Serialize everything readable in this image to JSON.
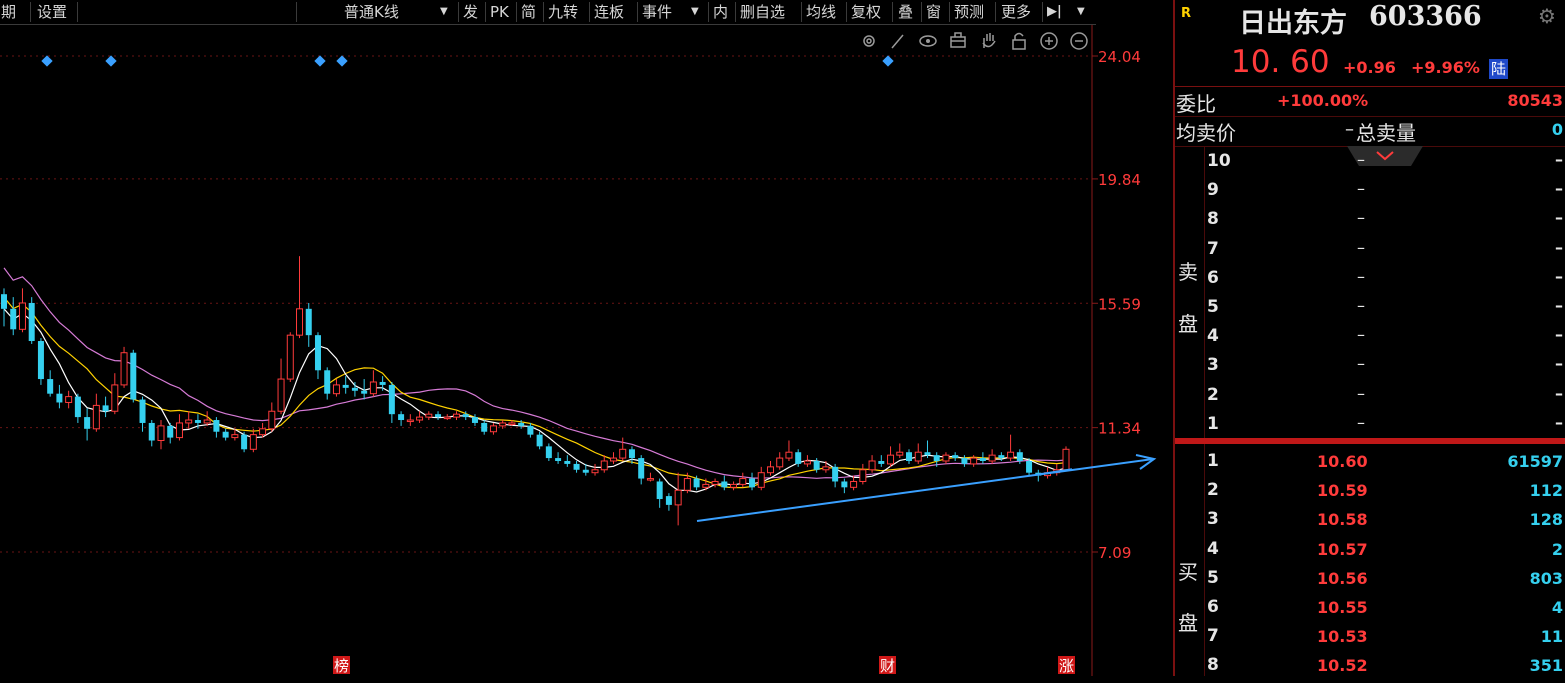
{
  "toolbar": {
    "items": [
      "周期",
      "设置",
      "普通K线",
      "发",
      "PK",
      "简",
      "九转",
      "连板",
      "事件",
      "内",
      "删自选",
      "均线",
      "复权",
      "叠",
      "窗",
      "预测",
      "更多"
    ],
    "dropdown_arrow": "▼",
    "expand_glyph": "▶|",
    "expand_arrow": "▼"
  },
  "chart_tools": [
    "gear-tool-icon",
    "pen-icon",
    "eye-icon",
    "lock-box-icon",
    "hand-icon",
    "lock-icon",
    "zoom-in-icon",
    "zoom-out-icon"
  ],
  "markers": {
    "bottom_labels": [
      "榜",
      "财",
      "涨"
    ]
  },
  "chart_data": {
    "type": "candlestick",
    "y_ticks": [
      "24.04",
      "19.84",
      "15.59",
      "11.34",
      "7.09"
    ],
    "ylim": [
      7.09,
      24.04
    ],
    "colors": {
      "up": "#ff3b3b",
      "down": "#35d0ef",
      "ma5": "#ffffff",
      "ma10": "#ffd200",
      "ma20": "#d67bd6",
      "trend": "#3aa0ff"
    },
    "candles": [
      [
        15.9,
        15.4,
        16.1,
        14.8
      ],
      [
        15.4,
        14.7,
        15.8,
        14.5
      ],
      [
        14.7,
        15.6,
        16.1,
        14.6
      ],
      [
        15.6,
        14.3,
        15.8,
        14.2
      ],
      [
        14.3,
        13.0,
        14.4,
        12.8
      ],
      [
        13.0,
        12.5,
        13.3,
        12.4
      ],
      [
        12.5,
        12.2,
        12.8,
        12.0
      ],
      [
        12.2,
        12.4,
        12.6,
        12.0
      ],
      [
        12.4,
        11.7,
        12.5,
        11.5
      ],
      [
        11.7,
        11.3,
        12.0,
        10.9
      ],
      [
        11.3,
        12.1,
        12.5,
        11.2
      ],
      [
        12.1,
        11.9,
        12.4,
        11.7
      ],
      [
        11.9,
        12.8,
        13.2,
        11.8
      ],
      [
        12.8,
        13.9,
        14.1,
        12.7
      ],
      [
        13.9,
        12.3,
        14.0,
        12.2
      ],
      [
        12.3,
        11.5,
        12.4,
        11.2
      ],
      [
        11.5,
        10.9,
        11.6,
        10.7
      ],
      [
        10.9,
        11.4,
        11.6,
        10.6
      ],
      [
        11.4,
        11.0,
        11.5,
        10.8
      ],
      [
        11.0,
        11.5,
        11.8,
        10.9
      ],
      [
        11.5,
        11.6,
        11.9,
        11.3
      ],
      [
        11.6,
        11.5,
        11.8,
        11.3
      ],
      [
        11.5,
        11.6,
        11.9,
        11.4
      ],
      [
        11.6,
        11.2,
        11.7,
        11.0
      ],
      [
        11.2,
        11.0,
        11.3,
        10.9
      ],
      [
        11.0,
        11.1,
        11.3,
        10.9
      ],
      [
        11.1,
        10.6,
        11.2,
        10.5
      ],
      [
        10.6,
        11.1,
        11.3,
        10.5
      ],
      [
        11.1,
        11.3,
        11.5,
        11.0
      ],
      [
        11.3,
        11.9,
        12.2,
        11.2
      ],
      [
        11.9,
        13.0,
        13.7,
        11.8
      ],
      [
        13.0,
        14.5,
        14.6,
        12.9
      ],
      [
        14.5,
        15.4,
        17.2,
        14.4
      ],
      [
        15.4,
        14.5,
        15.6,
        14.1
      ],
      [
        14.5,
        13.3,
        14.6,
        13.0
      ],
      [
        13.3,
        12.5,
        13.4,
        12.3
      ],
      [
        12.5,
        12.8,
        13.0,
        12.4
      ],
      [
        12.8,
        12.7,
        13.1,
        12.5
      ],
      [
        12.7,
        12.6,
        12.9,
        12.4
      ],
      [
        12.6,
        12.5,
        13.0,
        12.3
      ],
      [
        12.5,
        12.9,
        13.3,
        12.4
      ],
      [
        12.9,
        12.8,
        13.1,
        12.6
      ],
      [
        12.8,
        11.8,
        12.9,
        11.5
      ],
      [
        11.8,
        11.6,
        11.9,
        11.4
      ],
      [
        11.6,
        11.6,
        11.8,
        11.4
      ],
      [
        11.6,
        11.7,
        11.9,
        11.5
      ],
      [
        11.7,
        11.8,
        11.9,
        11.6
      ],
      [
        11.8,
        11.7,
        11.9,
        11.6
      ],
      [
        11.7,
        11.7,
        11.8,
        11.6
      ],
      [
        11.7,
        11.8,
        11.9,
        11.6
      ],
      [
        11.8,
        11.7,
        11.9,
        11.6
      ],
      [
        11.7,
        11.5,
        11.8,
        11.4
      ],
      [
        11.5,
        11.2,
        11.6,
        11.1
      ],
      [
        11.2,
        11.4,
        11.5,
        11.1
      ],
      [
        11.4,
        11.5,
        11.6,
        11.3
      ],
      [
        11.5,
        11.5,
        11.6,
        11.4
      ],
      [
        11.5,
        11.4,
        11.6,
        11.3
      ],
      [
        11.4,
        11.1,
        11.5,
        11.0
      ],
      [
        11.1,
        10.7,
        11.2,
        10.6
      ],
      [
        10.7,
        10.3,
        10.8,
        10.2
      ],
      [
        10.3,
        10.2,
        10.5,
        10.1
      ],
      [
        10.2,
        10.1,
        10.4,
        10.0
      ],
      [
        10.1,
        9.9,
        10.2,
        9.8
      ],
      [
        9.9,
        9.8,
        10.1,
        9.7
      ],
      [
        9.8,
        9.9,
        10.1,
        9.7
      ],
      [
        9.9,
        10.2,
        10.4,
        9.8
      ],
      [
        10.2,
        10.3,
        10.5,
        10.1
      ],
      [
        10.3,
        10.6,
        11.0,
        10.2
      ],
      [
        10.6,
        10.3,
        10.7,
        10.1
      ],
      [
        10.3,
        9.6,
        10.4,
        9.4
      ],
      [
        9.6,
        9.6,
        9.8,
        9.5
      ],
      [
        9.5,
        8.9,
        9.6,
        8.6
      ],
      [
        9.0,
        8.7,
        9.1,
        8.5
      ],
      [
        8.7,
        9.2,
        9.8,
        8.0
      ],
      [
        9.2,
        9.6,
        9.8,
        9.1
      ],
      [
        9.6,
        9.3,
        9.7,
        9.2
      ],
      [
        9.3,
        9.4,
        9.6,
        9.2
      ],
      [
        9.4,
        9.5,
        9.6,
        9.3
      ],
      [
        9.5,
        9.3,
        9.7,
        9.2
      ],
      [
        9.3,
        9.4,
        9.5,
        9.2
      ],
      [
        9.4,
        9.6,
        9.8,
        9.3
      ],
      [
        9.6,
        9.3,
        9.8,
        9.2
      ],
      [
        9.3,
        9.8,
        10.0,
        9.2
      ],
      [
        9.8,
        10.0,
        10.2,
        9.7
      ],
      [
        10.0,
        10.3,
        10.5,
        9.9
      ],
      [
        10.3,
        10.5,
        10.9,
        10.2
      ],
      [
        10.5,
        10.1,
        10.6,
        10.0
      ],
      [
        10.1,
        10.2,
        10.4,
        10.0
      ],
      [
        10.2,
        9.9,
        10.3,
        9.8
      ],
      [
        9.9,
        10.0,
        10.2,
        9.8
      ],
      [
        10.0,
        9.5,
        10.1,
        9.3
      ],
      [
        9.5,
        9.3,
        9.6,
        9.1
      ],
      [
        9.3,
        9.5,
        9.7,
        9.2
      ],
      [
        9.5,
        9.9,
        10.1,
        9.4
      ],
      [
        9.9,
        10.2,
        10.4,
        9.8
      ],
      [
        10.2,
        10.1,
        10.4,
        10.0
      ],
      [
        10.1,
        10.4,
        10.7,
        10.0
      ],
      [
        10.4,
        10.5,
        10.8,
        10.3
      ],
      [
        10.5,
        10.2,
        10.6,
        10.1
      ],
      [
        10.2,
        10.5,
        10.8,
        10.1
      ],
      [
        10.5,
        10.4,
        10.9,
        10.3
      ],
      [
        10.4,
        10.2,
        10.5,
        10.0
      ],
      [
        10.2,
        10.4,
        10.5,
        10.1
      ],
      [
        10.4,
        10.3,
        10.5,
        10.2
      ],
      [
        10.3,
        10.1,
        10.4,
        10.0
      ],
      [
        10.1,
        10.3,
        10.4,
        10.0
      ],
      [
        10.3,
        10.2,
        10.5,
        10.1
      ],
      [
        10.2,
        10.4,
        10.6,
        10.1
      ],
      [
        10.4,
        10.3,
        10.5,
        10.2
      ],
      [
        10.3,
        10.5,
        11.1,
        10.2
      ],
      [
        10.5,
        10.2,
        10.6,
        10.1
      ],
      [
        10.2,
        9.8,
        10.3,
        9.7
      ],
      [
        9.8,
        9.7,
        9.9,
        9.5
      ],
      [
        9.7,
        9.8,
        10.0,
        9.6
      ],
      [
        9.8,
        9.9,
        10.1,
        9.7
      ],
      [
        9.9,
        10.6,
        10.7,
        9.9
      ]
    ]
  },
  "quote": {
    "badge": "R",
    "name": "日出东方",
    "code": "603366",
    "price": "10. 60",
    "change": "+0.96",
    "change_pct": "+9.96%",
    "market_tag": "陆",
    "wb_label": "委比",
    "wb_value": "+100.00%",
    "wb_diff": "80543",
    "avg_sell_label": "均卖价",
    "avg_sell_value": "–",
    "total_sell_label": "总卖量",
    "total_sell_value": "0",
    "sell_side_label": [
      "卖",
      "盘"
    ],
    "buy_side_label": [
      "买",
      "盘"
    ],
    "sell_rows": [
      {
        "level": "10",
        "price": "–",
        "vol": "–"
      },
      {
        "level": "9",
        "price": "–",
        "vol": "–"
      },
      {
        "level": "8",
        "price": "–",
        "vol": "–"
      },
      {
        "level": "7",
        "price": "–",
        "vol": "–"
      },
      {
        "level": "6",
        "price": "–",
        "vol": "–"
      },
      {
        "level": "5",
        "price": "–",
        "vol": "–"
      },
      {
        "level": "4",
        "price": "–",
        "vol": "–"
      },
      {
        "level": "3",
        "price": "–",
        "vol": "–"
      },
      {
        "level": "2",
        "price": "–",
        "vol": "–"
      },
      {
        "level": "1",
        "price": "–",
        "vol": "–"
      }
    ],
    "buy_rows": [
      {
        "level": "1",
        "price": "10.60",
        "vol": "61597"
      },
      {
        "level": "2",
        "price": "10.59",
        "vol": "112"
      },
      {
        "level": "3",
        "price": "10.58",
        "vol": "128"
      },
      {
        "level": "4",
        "price": "10.57",
        "vol": "2"
      },
      {
        "level": "5",
        "price": "10.56",
        "vol": "803"
      },
      {
        "level": "6",
        "price": "10.55",
        "vol": "4"
      },
      {
        "level": "7",
        "price": "10.53",
        "vol": "11"
      },
      {
        "level": "8",
        "price": "10.52",
        "vol": "351"
      }
    ]
  }
}
